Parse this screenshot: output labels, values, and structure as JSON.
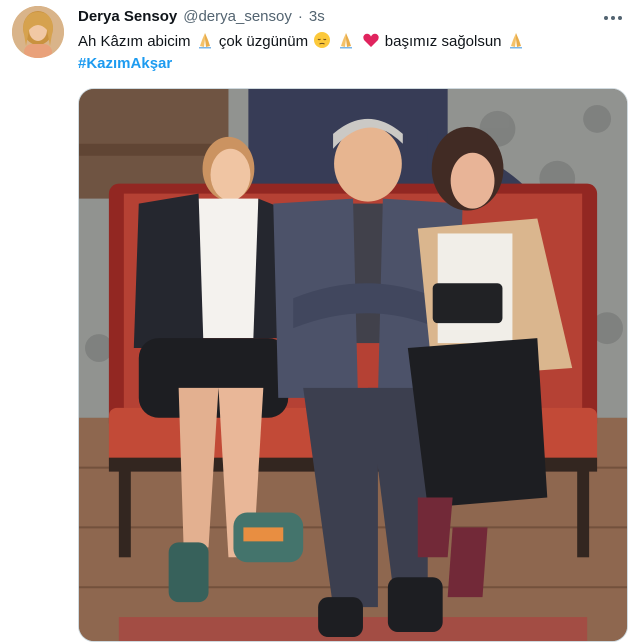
{
  "tweet": {
    "display_name": "Derya Sensoy",
    "handle": "@derya_sensoy",
    "separator": "·",
    "time": "3s",
    "text_segments": {
      "part1": "Ah Kâzım abicim",
      "part2": "çok üzgünüm",
      "part3": "başımız sağolsun"
    },
    "hashtag": "#KazımAkşar",
    "icons": {
      "more": "more-horizontal-icon",
      "emoji_1": "folded-hands-emoji",
      "emoji_2": "pensive-face-emoji",
      "emoji_3": "folded-hands-emoji",
      "emoji_4": "red-heart-emoji",
      "emoji_5": "folded-hands-emoji"
    },
    "colors": {
      "hashtag": "#1d9bf0",
      "secondary_text": "#536471",
      "heart": "#e0245e"
    }
  }
}
